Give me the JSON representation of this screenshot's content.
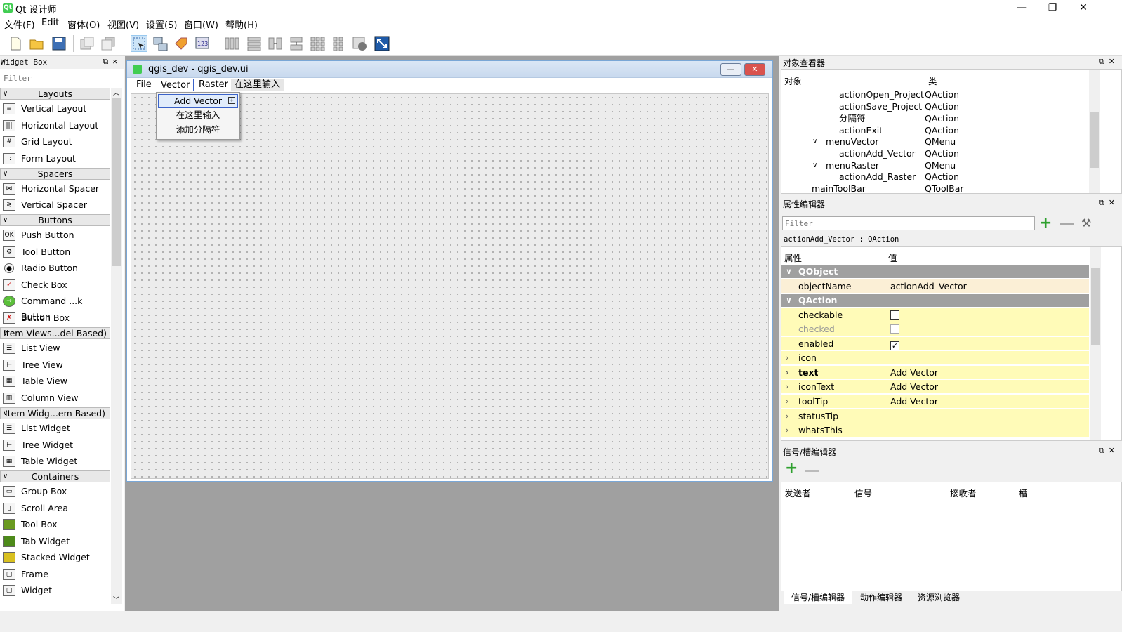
{
  "window": {
    "title": "Qt 设计师",
    "logo": "Qt",
    "min": "—",
    "max": "❐",
    "close": "✕"
  },
  "menubar": [
    "文件(F)",
    "Edit",
    "窗体(O)",
    "视图(V)",
    "设置(S)",
    "窗口(W)",
    "帮助(H)"
  ],
  "widget_box": {
    "title": "Widget Box",
    "filter_placeholder": "Filter",
    "categories": {
      "layouts": "Layouts",
      "spacers": "Spacers",
      "buttons": "Buttons",
      "item_views": "Item Views...del-Based)",
      "item_widgets": "Item Widg...em-Based)",
      "containers": "Containers"
    },
    "items": {
      "vertical_layout": "Vertical Layout",
      "horizontal_layout": "Horizontal Layout",
      "grid_layout": "Grid Layout",
      "form_layout": "Form Layout",
      "horizontal_spacer": "Horizontal Spacer",
      "vertical_spacer": "Vertical Spacer",
      "push_button": "Push Button",
      "tool_button": "Tool Button",
      "radio_button": "Radio Button",
      "check_box": "Check Box",
      "command_link_button": "Command ...k Button",
      "button_box": "Button Box",
      "list_view": "List View",
      "tree_view": "Tree View",
      "table_view": "Table View",
      "column_view": "Column View",
      "list_widget": "List Widget",
      "tree_widget": "Tree Widget",
      "table_widget": "Table Widget",
      "group_box": "Group Box",
      "scroll_area": "Scroll Area",
      "tool_box": "Tool Box",
      "tab_widget": "Tab Widget",
      "stacked_widget": "Stacked Widget",
      "frame": "Frame",
      "widget": "Widget"
    }
  },
  "form": {
    "title": "qgis_dev - qgis_dev.ui",
    "menus": [
      "File",
      "Vector",
      "Raster",
      "在这里输入"
    ],
    "popup": [
      "Add Vector",
      "在这里输入",
      "添加分隔符"
    ]
  },
  "object_inspector": {
    "title": "对象查看器",
    "col_object": "对象",
    "col_class": "类",
    "rows": [
      {
        "name": "actionOpen_Project",
        "cls": "QAction"
      },
      {
        "name": "actionSave_Project",
        "cls": "QAction"
      },
      {
        "name": "分隔符",
        "cls": "QAction"
      },
      {
        "name": "actionExit",
        "cls": "QAction"
      },
      {
        "name": "menuVector",
        "cls": "QMenu"
      },
      {
        "name": "actionAdd_Vector",
        "cls": "QAction"
      },
      {
        "name": "menuRaster",
        "cls": "QMenu"
      },
      {
        "name": "actionAdd_Raster",
        "cls": "QAction"
      },
      {
        "name": "mainToolBar",
        "cls": "QToolBar"
      }
    ]
  },
  "property_editor": {
    "title": "属性编辑器",
    "filter_placeholder": "Filter",
    "context": "actionAdd_Vector : QAction",
    "col_prop": "属性",
    "col_value": "值",
    "group_qobject": "QObject",
    "group_qaction": "QAction",
    "rows": {
      "objectName": {
        "name": "objectName",
        "value": "actionAdd_Vector"
      },
      "checkable": {
        "name": "checkable"
      },
      "checked": {
        "name": "checked"
      },
      "enabled": {
        "name": "enabled",
        "value": "✓"
      },
      "icon": {
        "name": "icon"
      },
      "text": {
        "name": "text",
        "value": "Add Vector"
      },
      "iconText": {
        "name": "iconText",
        "value": "Add Vector"
      },
      "toolTip": {
        "name": "toolTip",
        "value": "Add Vector"
      },
      "statusTip": {
        "name": "statusTip"
      },
      "whatsThis": {
        "name": "whatsThis"
      }
    }
  },
  "signal_slot": {
    "title": "信号/槽编辑器",
    "cols": [
      "发送者",
      "信号",
      "接收者",
      "槽"
    ]
  },
  "bottom_tabs": [
    "信号/槽编辑器",
    "动作编辑器",
    "资源浏览器"
  ],
  "colors": {
    "accent": "#3b63c9",
    "group": "#a0a0a0",
    "highlight_row": "#fffbb8",
    "selected_row": "#fbefd6"
  }
}
